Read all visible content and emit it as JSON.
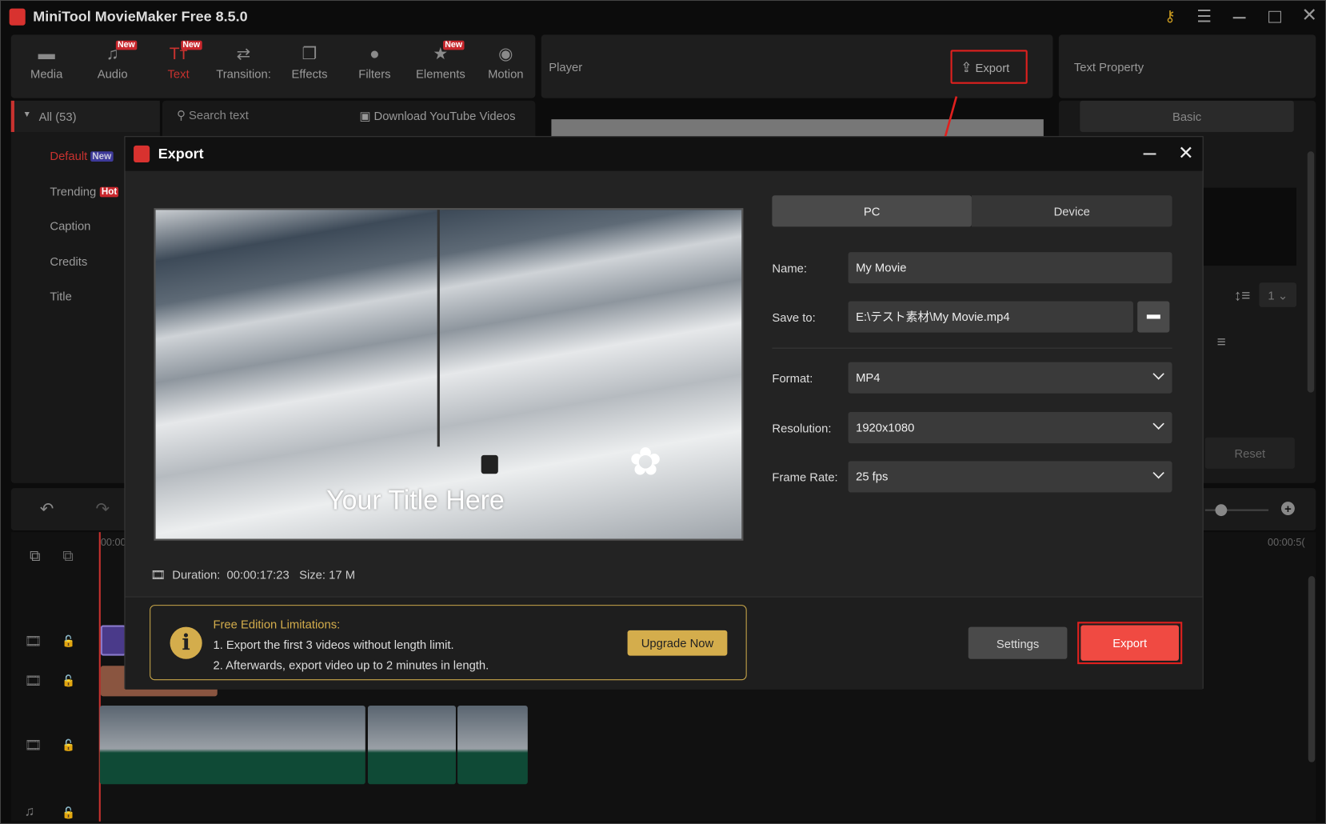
{
  "app": {
    "title": "MiniTool MovieMaker Free 8.5.0"
  },
  "toolbar": {
    "items": [
      {
        "label": "Media",
        "icon": "folder-icon",
        "badge": null
      },
      {
        "label": "Audio",
        "icon": "music-icon",
        "badge": "New"
      },
      {
        "label": "Text",
        "icon": "text-icon",
        "badge": "New",
        "active": true
      },
      {
        "label": "Transition:",
        "icon": "transition-icon",
        "badge": null
      },
      {
        "label": "Effects",
        "icon": "effects-icon",
        "badge": null
      },
      {
        "label": "Filters",
        "icon": "filters-icon",
        "badge": null
      },
      {
        "label": "Elements",
        "icon": "elements-icon",
        "badge": "New"
      },
      {
        "label": "Motion",
        "icon": "motion-icon",
        "badge": null
      }
    ]
  },
  "player": {
    "label": "Player",
    "export_label": "Export"
  },
  "text_property": {
    "label": "Text Property",
    "basic_tab": "Basic",
    "reset_label": "Reset",
    "line_spacing": "1"
  },
  "library": {
    "all_label": "All (53)",
    "search_placeholder": "Search text",
    "download_label": "Download YouTube Videos",
    "categories": [
      {
        "label": "Default",
        "badge": "New",
        "active": true
      },
      {
        "label": "Trending",
        "badge": "Hot"
      },
      {
        "label": "Caption"
      },
      {
        "label": "Credits"
      },
      {
        "label": "Title"
      }
    ]
  },
  "timeline": {
    "time_start": "00:00",
    "time_end": "00:00:5("
  },
  "export_dialog": {
    "title": "Export",
    "preview_title": "Your Title Here",
    "duration_label": "Duration:",
    "duration": "00:00:17:23",
    "size_label": "Size:",
    "size": "17 M",
    "tabs": [
      {
        "label": "PC",
        "active": true
      },
      {
        "label": "Device"
      }
    ],
    "name_label": "Name:",
    "name_value": "My Movie",
    "save_label": "Save to:",
    "save_value": "E:\\テスト素材\\My Movie.mp4",
    "format_label": "Format:",
    "format_value": "MP4",
    "resolution_label": "Resolution:",
    "resolution_value": "1920x1080",
    "framerate_label": "Frame Rate:",
    "framerate_value": "25 fps",
    "limits_title": "Free Edition Limitations:",
    "limits_1": "1. Export the first 3 videos without length limit.",
    "limits_2": "2. Afterwards, export video up to 2 minutes in length.",
    "upgrade_label": "Upgrade Now",
    "settings_label": "Settings",
    "export_label": "Export"
  },
  "colors": {
    "accent_red": "#f04a42",
    "highlight_border": "#e0201e",
    "gold": "#d4ad4c"
  }
}
